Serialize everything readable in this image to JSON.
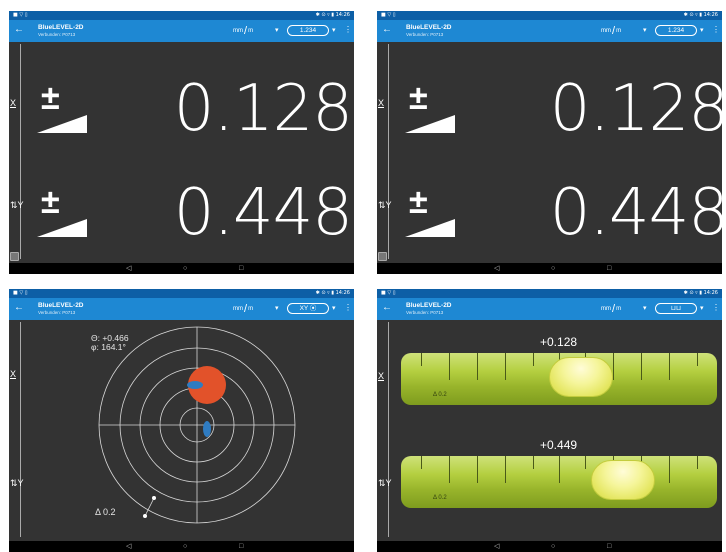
{
  "app": {
    "title": "BlueLEVEL-2D",
    "subtitle": "Verbunden: P0713",
    "status_left": "■ ▽ ▯",
    "status_right": "✱ ⊙ ▿ ▮ 14:26",
    "unit_num": "mm",
    "unit_slash": "/",
    "unit_den": "m",
    "menu_icon": "⋮",
    "dropdown_glyph": "▾"
  },
  "nav": {
    "back": "◁",
    "home": "○",
    "recents": "□"
  },
  "axes": {
    "x": "X",
    "y": "⇅Y"
  },
  "numeric_view": {
    "mode_value": "1.234",
    "x_value": "0.128",
    "y_value": "0.448",
    "sign_glyph": "±"
  },
  "polar_view": {
    "mode_value": "XY ⦿",
    "theta": "Θ: +0.466",
    "phi": "φ: 164.1°",
    "delta": "Δ 0.2",
    "colors": {
      "spot": "#e2522a",
      "marker": "#2f7cc2"
    }
  },
  "level_view": {
    "mode_value": "⊔⊔",
    "x_value": "+0.128",
    "y_value": "+0.449",
    "scale_label": "Δ 0.2",
    "colors": {
      "vial": "#a6c236",
      "bubble": "#f0f28a"
    }
  }
}
